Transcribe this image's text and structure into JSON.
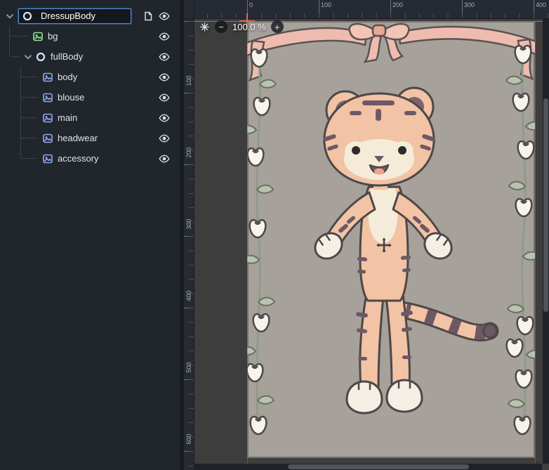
{
  "scene_tree": {
    "nodes": [
      {
        "label": "DressupBody",
        "type": "node2d",
        "state": "renaming"
      },
      {
        "label": "bg",
        "type": "texture"
      },
      {
        "label": "fullBody",
        "type": "node2d"
      },
      {
        "label": "body",
        "type": "sprite"
      },
      {
        "label": "blouse",
        "type": "sprite"
      },
      {
        "label": "main",
        "type": "sprite"
      },
      {
        "label": "headwear",
        "type": "sprite"
      },
      {
        "label": "accessory",
        "type": "sprite"
      }
    ]
  },
  "viewport": {
    "zoom_label": "100.0 %",
    "zoom_out_glyph": "−",
    "zoom_in_glyph": "+",
    "h_ruler_labels": [
      "0",
      "100",
      "200",
      "300",
      "400"
    ],
    "v_ruler_labels": [
      "100",
      "200",
      "300",
      "400",
      "500",
      "600"
    ]
  },
  "icons": {
    "visibility": "eye-icon",
    "collapse": "chevron-down-icon",
    "node2d": "circle-node-icon",
    "sprite": "picture-icon",
    "texture": "picture-icon",
    "scene_root": "scene-file-icon",
    "zoom_out": "minus-circle-icon",
    "zoom_in": "plus-circle-icon",
    "center_view": "asterisk-icon",
    "origin": "origin-cross-marker"
  },
  "colors": {
    "accent_blue": "#4d8fd4",
    "panel_bg": "#21262d",
    "viewport_bg": "#3d3d3d",
    "canvas_bg": "#a6a19b",
    "axis_line": "#d55480",
    "origin_marker": "#e5685c",
    "sprite_icon_blue": "#8fa9f5",
    "texture_icon_green": "#8ee69a",
    "character_peach": "#f2c3a4",
    "character_cream": "#f4ecd8",
    "character_stripe_plum": "#6e5866",
    "ribbon_pink": "#eebcae",
    "vine_green": "#8f9c8a"
  }
}
